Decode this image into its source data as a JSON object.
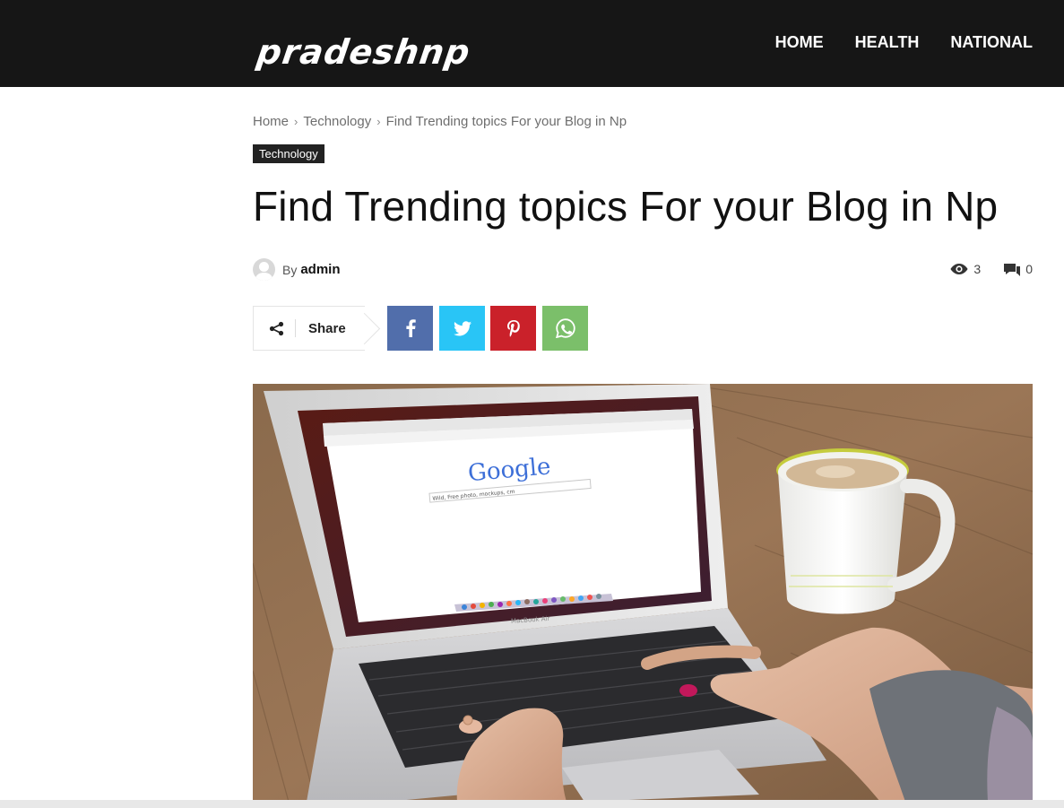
{
  "header": {
    "logo": "pradeshnp",
    "nav": [
      "HOME",
      "HEALTH",
      "NATIONAL"
    ]
  },
  "breadcrumb": [
    "Home",
    "Technology",
    "Find Trending topics For your Blog in Np"
  ],
  "breadcrumb_separator": "›",
  "category": "Technology",
  "article": {
    "title": "Find Trending topics For your Blog in Np",
    "by_label": "By",
    "author": "admin",
    "views": "3",
    "comments": "0"
  },
  "share": {
    "label": "Share",
    "buttons": [
      "facebook-icon",
      "twitter-icon",
      "pinterest-icon",
      "whatsapp-icon"
    ]
  },
  "hero_image": {
    "google_logo": "Google",
    "search_text": "Wild, Free photo, mockups, cm",
    "laptop_brand": "MacBook Air"
  },
  "colors": {
    "header_bg": "#161616",
    "facebook": "#516eab",
    "twitter": "#29c5f6",
    "pinterest": "#ca212a",
    "whatsapp": "#7bbf6a"
  }
}
